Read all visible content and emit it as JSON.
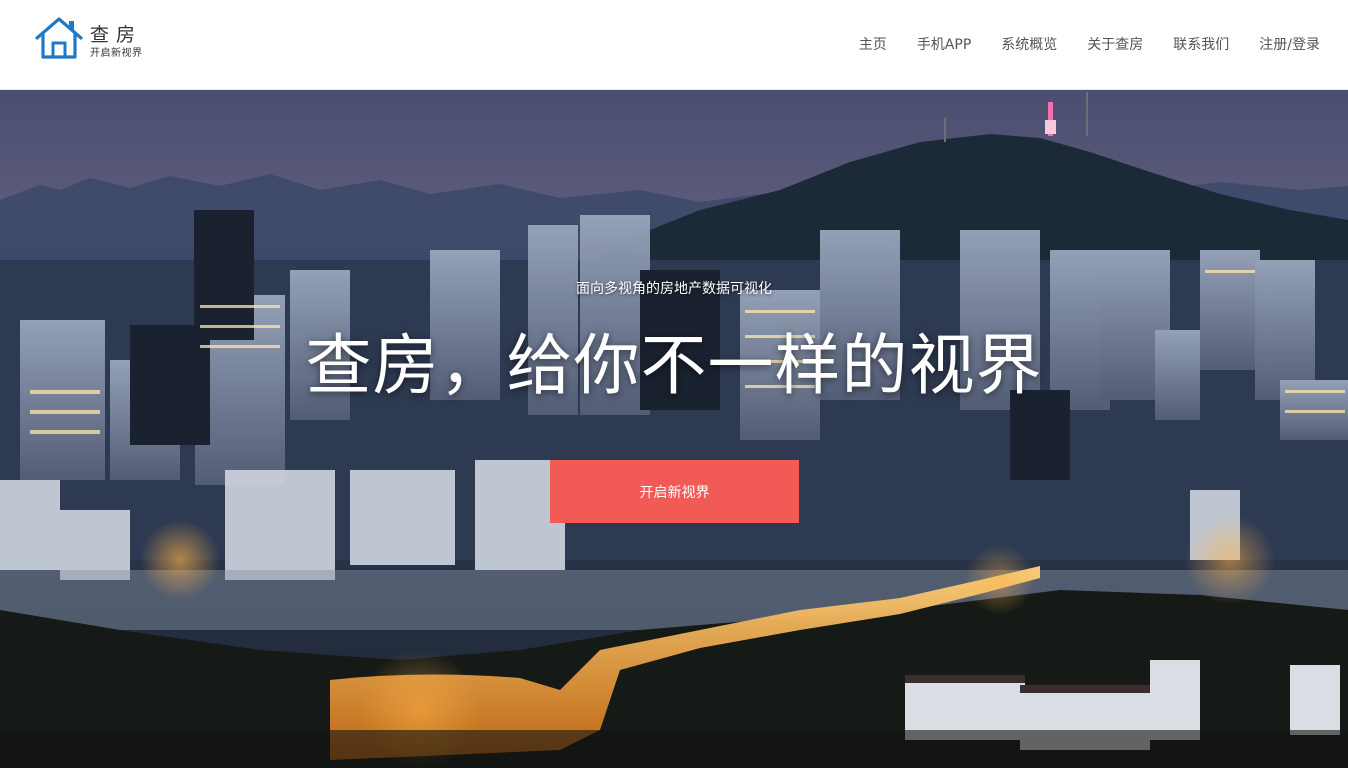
{
  "brand": {
    "title": "查房",
    "subtitle": "开启新视界",
    "logo_icon": "house-icon",
    "accent_color": "#1f7ac6"
  },
  "nav": {
    "items": [
      "主页",
      "手机APP",
      "系统概览",
      "关于查房",
      "联系我们",
      "注册/登录"
    ]
  },
  "hero": {
    "subtitle": "面向多视角的房地产数据可视化",
    "title": "查房，给你不一样的视界",
    "cta_label": "开启新视界",
    "cta_color": "#f25a55",
    "background": "night-city-skyline-image"
  }
}
